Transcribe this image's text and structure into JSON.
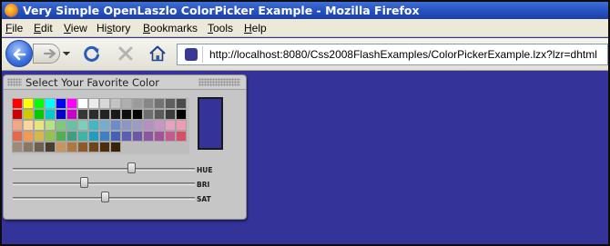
{
  "window": {
    "title": "Very Simple OpenLaszlo ColorPicker Example - Mozilla Firefox"
  },
  "menu": [
    {
      "label": "File",
      "accel": "F",
      "rest": "ile"
    },
    {
      "label": "Edit",
      "accel": "E",
      "rest": "dit"
    },
    {
      "label": "View",
      "accel": "V",
      "rest": "iew"
    },
    {
      "label": "History",
      "accel": "s",
      "pre": "Hi",
      "rest": "tory"
    },
    {
      "label": "Bookmarks",
      "accel": "B",
      "rest": "ookmarks"
    },
    {
      "label": "Tools",
      "accel": "T",
      "rest": "ools"
    },
    {
      "label": "Help",
      "accel": "H",
      "rest": "elp"
    }
  ],
  "toolbar": {
    "back_icon": "back-arrow-icon",
    "forward_icon": "forward-arrow-icon",
    "reload_icon": "reload-icon",
    "stop_icon": "stop-icon",
    "home_icon": "home-icon",
    "url": "http://localhost:8080/Css2008FlashExamples/ColorPickerExample.lzx?lzr=dhtml"
  },
  "picker": {
    "title": "Select Your Favorite Color",
    "selected_color": "#33339a",
    "swatch_rows": [
      [
        "#ff0000",
        "#ffff00",
        "#00ff00",
        "#00ffff",
        "#0000ff",
        "#ff00ff",
        "#ffffff",
        "#ebebeb",
        "#d7d7d7",
        "#c3c3c3",
        "#afafaf",
        "#9b9b9b",
        "#878787",
        "#737373",
        "#5f5f5f",
        "#4b4b4b"
      ],
      [
        "#cc0000",
        "#cccc00",
        "#00cc00",
        "#00cccc",
        "#0000cc",
        "#cc00cc",
        "#373737",
        "#2d2d2d",
        "#232323",
        "#191919",
        "#0f0f0f",
        "#050505",
        "#6e6e6e",
        "#5a5a5a",
        "#3c3c3c",
        "#000000"
      ],
      [
        "#f4a582",
        "#fdd49e",
        "#e6e47f",
        "#b8e186",
        "#7fc97f",
        "#66c2a5",
        "#7fcdbb",
        "#41b6c4",
        "#74add1",
        "#6b8ccf",
        "#8c96c6",
        "#9e9ac8",
        "#b78ec2",
        "#c994c7",
        "#e7a0c0",
        "#f09bb4"
      ],
      [
        "#e8664a",
        "#f29b4c",
        "#d9b84a",
        "#95c24a",
        "#4fb04f",
        "#3f9f80",
        "#3db4a6",
        "#1f9ec1",
        "#3f7fc6",
        "#4460b8",
        "#5a5fb5",
        "#6d57a8",
        "#8d55a5",
        "#a4509a",
        "#c65a8e",
        "#d65066"
      ],
      [
        "#9e8a77",
        "#8a7866",
        "#6e5f4f",
        "#4a3d30",
        "#c9955a",
        "#b0783d",
        "#8e5a25",
        "#6e4516",
        "#4d2e0c",
        "#3a2208"
      ]
    ],
    "sliders": [
      {
        "label": "HUE",
        "value": 0.66
      },
      {
        "label": "BRI",
        "value": 0.39
      },
      {
        "label": "SAT",
        "value": 0.51
      }
    ]
  }
}
